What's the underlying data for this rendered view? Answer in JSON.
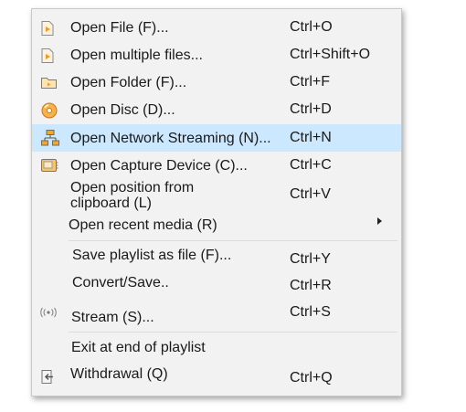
{
  "menu": {
    "items": [
      {
        "label": "Open File (F)...",
        "shortcut": "Ctrl+O",
        "icon": "file-media-icon"
      },
      {
        "label": "Open multiple files...",
        "shortcut": "Ctrl+Shift+O",
        "icon": "file-media-icon"
      },
      {
        "label": "Open Folder (F)...",
        "shortcut": "Ctrl+F",
        "icon": "folder-icon"
      },
      {
        "label": "Open Disc (D)...",
        "shortcut": "Ctrl+D",
        "icon": "disc-icon"
      },
      {
        "label": "Open Network Streaming (N)...",
        "shortcut": "Ctrl+N",
        "icon": "network-icon",
        "highlighted": true
      },
      {
        "label": "Open Capture Device (C)...",
        "shortcut": "Ctrl+C",
        "icon": "capture-card-icon"
      },
      {
        "label_line1": "Open position from",
        "label_line2": "clipboard (L)",
        "shortcut": "Ctrl+V"
      },
      {
        "label": "Open recent media (R)",
        "submenu": true
      },
      {
        "label": "Save playlist as file (F)...",
        "shortcut": "Ctrl+Y"
      },
      {
        "label": "Convert/Save..",
        "shortcut": "Ctrl+R"
      },
      {
        "label": "Stream (S)...",
        "shortcut": "Ctrl+S",
        "icon": "stream-icon"
      },
      {
        "label": "Exit at end of playlist"
      },
      {
        "label": "Withdrawal (Q)",
        "shortcut": "Ctrl+Q",
        "icon": "exit-icon"
      }
    ]
  },
  "colors": {
    "highlight": "#cce8ff",
    "menu_bg": "#f2f2f2",
    "icon_orange": "#f39a1e"
  }
}
